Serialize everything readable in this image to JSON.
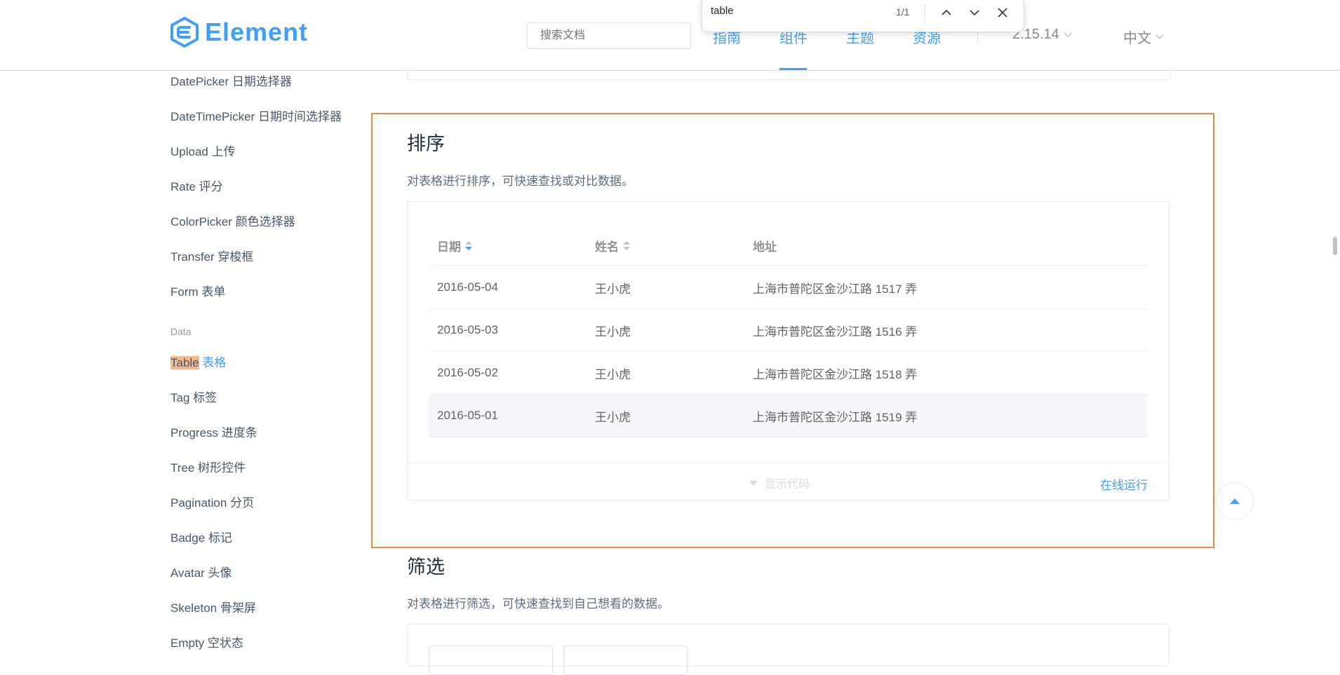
{
  "header": {
    "logo_text": "Element",
    "search_placeholder": "搜索文档",
    "nav": [
      "指南",
      "组件",
      "主题",
      "资源"
    ],
    "version": "2.15.14",
    "language": "中文"
  },
  "findbar": {
    "query": "table",
    "count": "1/1"
  },
  "sidebar": {
    "items_top": [
      "DatePicker 日期选择器",
      "DateTimePicker 日期时间选择器",
      "Upload 上传",
      "Rate 评分",
      "ColorPicker 颜色选择器",
      "Transfer 穿梭框",
      "Form 表单"
    ],
    "group": "Data",
    "active_highlight": "Table",
    "active_rest": " 表格",
    "items_bottom": [
      "Tag 标签",
      "Progress 进度条",
      "Tree 树形控件",
      "Pagination 分页",
      "Badge 标记",
      "Avatar 头像",
      "Skeleton 骨架屏",
      "Empty 空状态"
    ]
  },
  "section_sort": {
    "title": "排序",
    "description": "对表格进行排序，可快速查找或对比数据。",
    "columns": [
      "日期",
      "姓名",
      "地址"
    ],
    "rows": [
      [
        "2016-05-04",
        "王小虎",
        "上海市普陀区金沙江路 1517 弄"
      ],
      [
        "2016-05-03",
        "王小虎",
        "上海市普陀区金沙江路 1516 弄"
      ],
      [
        "2016-05-02",
        "王小虎",
        "上海市普陀区金沙江路 1518 弄"
      ],
      [
        "2016-05-01",
        "王小虎",
        "上海市普陀区金沙江路 1519 弄"
      ]
    ],
    "show_code": "显示代码",
    "run_online": "在线运行"
  },
  "section_filter": {
    "title": "筛选",
    "description": "对表格进行筛选，可快速查找到自己想看的数据。"
  },
  "colors": {
    "primary": "#409eff",
    "focus_border": "#f0883e",
    "find_highlight": "#f6b78a"
  }
}
